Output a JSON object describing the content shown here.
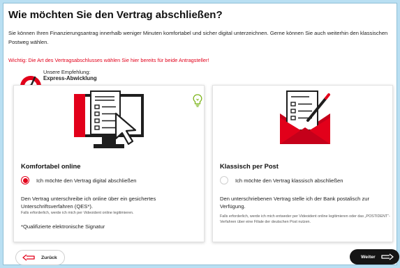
{
  "page": {
    "title": "Wie möchten Sie den Vertrag abschließen?",
    "intro": "Sie können Ihren Finanzierungsantrag innerhalb weniger Minuten komfortabel und sicher digital unterzeichnen. Gerne können Sie auch weiterhin den klassischen Postweg wählen.",
    "warning": "Wichtig: Die Art des Vertragsabschlusses wählen Sie hier bereits für beide Antragsteller!"
  },
  "recommendation": {
    "label": "Unsere Empfehlung:",
    "value": "Express-Abwicklung"
  },
  "options": {
    "digital": {
      "title": "Komfortabel online",
      "radio_label": "Ich möchte den Vertrag digital abschließen",
      "selected": true,
      "description": "Den Vertrag unterschreibe ich online über ein gesichertes Unterschriftsverfahren (QES*).",
      "note": "Falls erforderlich, werde ich mich per Videoident online legitimieren.",
      "footnote": "*Qualifizierte elektronische Signatur"
    },
    "post": {
      "title": "Klassisch per Post",
      "radio_label": "Ich möchte den Vertrag klassisch abschließen",
      "selected": false,
      "description": "Den unterschriebenen Vertrag stelle ich der Bank postalisch zur Verfügung.",
      "note": "Falls erforderlich, werde ich mich entweder per Videoident online legitimieren oder das „POSTIDENT“-Verfahren über eine Filiale der deutschen Post nutzen."
    }
  },
  "navigation": {
    "back_label": "Zurück",
    "next_label": "Weiter"
  },
  "colors": {
    "accent": "#e2001a",
    "background": "#b9dff2",
    "hint_icon": "#7ab317"
  },
  "icons": [
    "speedometer-icon",
    "lightbulb-icon",
    "monitor-cursor-icon",
    "envelope-pen-icon",
    "arrow-left-icon",
    "arrow-right-icon"
  ]
}
